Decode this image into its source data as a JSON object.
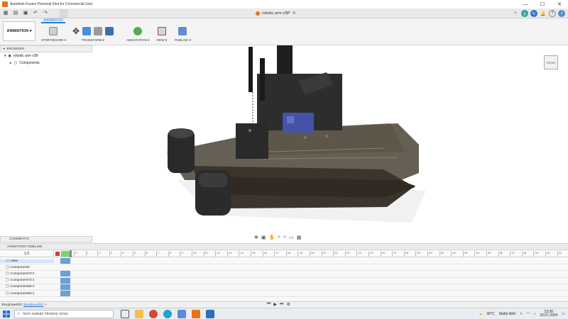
{
  "window": {
    "title": "Autodesk Fusion Personal (Not for Commercial Use)",
    "controls": [
      "—",
      "☐",
      "✕"
    ]
  },
  "document_tab": {
    "name": "robotic arm v38*"
  },
  "ribbon": {
    "workspace_label": "ANIMATION",
    "active_tab": "ANIMATION",
    "groups": [
      {
        "label": "STORYBOARD ▾"
      },
      {
        "label": "TRANSFORM ▾"
      },
      {
        "label": "ANNOTATION ▾"
      },
      {
        "label": "VIEW ▾"
      },
      {
        "label": "PUBLISH ▾"
      }
    ]
  },
  "browser": {
    "header": "BROWSER",
    "root": "robotic arm v38",
    "child": "Components"
  },
  "viewcube": {
    "label": "FRONT"
  },
  "comments": {
    "label": "COMMENTS"
  },
  "timeline": {
    "header": "ANIMATION TIMELINE",
    "speed": "1.0",
    "ticks": [
      "0",
      "1",
      "2",
      "3",
      "4",
      "5",
      "6",
      "7",
      "8",
      "9",
      "10",
      "11",
      "12",
      "13",
      "14",
      "15",
      "16",
      "17",
      "18",
      "19",
      "20",
      "21",
      "22",
      "23",
      "24",
      "25",
      "26",
      "27",
      "28",
      "29",
      "30",
      "31",
      "32",
      "33",
      "34",
      "35",
      "36",
      "37",
      "38",
      "39",
      "40",
      "41",
      "42"
    ],
    "rows": [
      {
        "name": "View",
        "selected": true,
        "has_cell": true
      },
      {
        "name": "Components",
        "selected": false,
        "has_cell": false
      },
      {
        "name": "Component73:1",
        "selected": false,
        "has_cell": true
      },
      {
        "name": "Component72:1",
        "selected": false,
        "has_cell": true
      },
      {
        "name": "Component60:1",
        "selected": false,
        "has_cell": true
      },
      {
        "name": "Component83:1",
        "selected": false,
        "has_cell": true
      }
    ]
  },
  "storyboards": {
    "items": [
      "Storyboard10",
      "Storyboard11"
    ],
    "active": "Storyboard11",
    "add": "+"
  },
  "taskbar": {
    "search_placeholder": "Sem zadejte hledaný výraz.",
    "weather_temp": "30°C",
    "weather_text": "Slabý déšť",
    "time": "13:30",
    "date": "23.07.2024"
  },
  "colors": {
    "accent": "#1f7fd6",
    "fusion_orange": "#e8731a",
    "timeline_cell": "#6a9fd8",
    "model_dark": "#2a2a2a",
    "model_glass": "#4a4336",
    "servo_blue": "#4453a8"
  }
}
